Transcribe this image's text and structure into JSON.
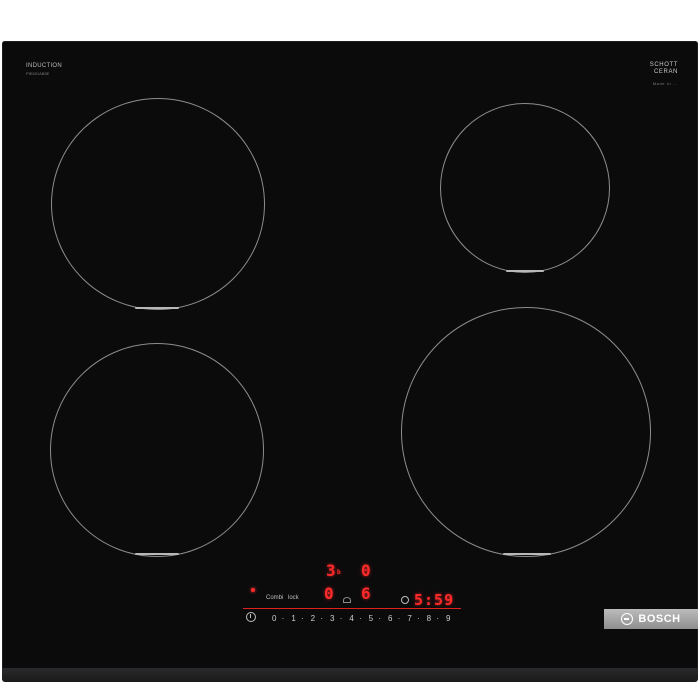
{
  "header": {
    "type_label": "INDUCTION",
    "model_code": "PIE631AB5E",
    "glass_brand_line1": "SCHOTT",
    "glass_brand_line2": "CERAN",
    "glass_sub": "Made in ..."
  },
  "zones": [
    {
      "name": "front-left"
    },
    {
      "name": "rear-left"
    },
    {
      "name": "front-right"
    },
    {
      "name": "rear-right"
    }
  ],
  "display": {
    "zone_rear_left_value": "3",
    "zone_rear_left_sub": "b",
    "zone_rear_right_value": "0",
    "zone_front_left_value": "0",
    "zone_front_right_value": "6",
    "timer_value": "5:59"
  },
  "controls": {
    "slider_steps": [
      "0",
      "·",
      "1",
      "·",
      "2",
      "·",
      "3",
      "·",
      "4",
      "·",
      "5",
      "·",
      "6",
      "·",
      "7",
      "·",
      "8",
      "·",
      "9"
    ],
    "combi_label": "Combi",
    "lock_label": "lock"
  },
  "brand": {
    "name": "BOSCH"
  },
  "colors": {
    "glass": "#0b0b0c",
    "display_red": "#ff2a2a",
    "plate": "#a8a8a8"
  }
}
